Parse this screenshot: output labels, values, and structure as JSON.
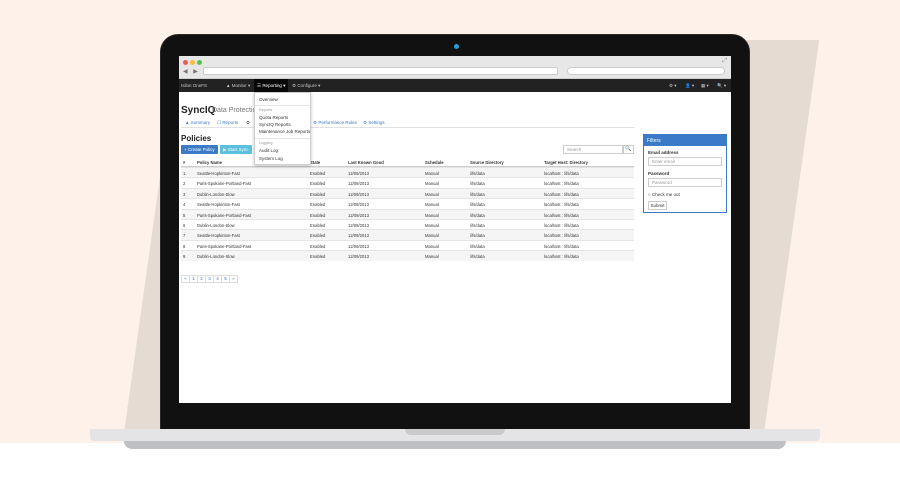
{
  "browser": {
    "url": "",
    "search_placeholder": "",
    "nav_buttons": "◀ ▶",
    "resize_glyph": "⤢"
  },
  "navbar": {
    "brand": "Isilon OneFS",
    "items": [
      {
        "label": "Monitor ▾",
        "icon": "monitor-icon"
      },
      {
        "label": "Reporting ▾",
        "icon": "table-icon",
        "active": true
      },
      {
        "label": "Configure ▾",
        "icon": "gear-icon"
      }
    ],
    "right": [
      "⚙ ▾",
      "👤 ▾",
      "▦ ▾",
      "🔍 ▾"
    ]
  },
  "page": {
    "title": "SyncIQ",
    "subtitle": "Data Protection"
  },
  "tabs": [
    "Summary",
    "Reports",
    "Performance Rules",
    "Settings"
  ],
  "tab_icons": [
    "bar-chart-icon",
    "document-icon",
    "gear-icon",
    "gear-icon"
  ],
  "policies": {
    "heading": "Policies",
    "create_button": "Create Policy",
    "start_sync_button": "Start Sync",
    "search_placeholder": "Search",
    "search_button": "🔍",
    "columns": [
      "#",
      "Policy Name",
      "State",
      "Last Known Good",
      "Schedule",
      "Source Directory",
      "Target Host: Directory"
    ],
    "rows": [
      [
        "1",
        "Seattle-Hopkinton-Fast",
        "Enabled",
        "12/09/2013",
        "Manual",
        "/ifs/data",
        "localhost : /ifs/data"
      ],
      [
        "2",
        "Paris-Spokane-Portland-Fast",
        "Enabled",
        "12/09/2013",
        "Manual",
        "/ifs/data",
        "localhost : /ifs/data"
      ],
      [
        "3",
        "Dublin-London-Slow",
        "Enabled",
        "12/09/2013",
        "Manual",
        "/ifs/data",
        "localhost : /ifs/data"
      ],
      [
        "4",
        "Seattle-Hopkinton-Fast",
        "Enabled",
        "12/09/2013",
        "Manual",
        "/ifs/data",
        "localhost : /ifs/data"
      ],
      [
        "5",
        "Paris-Spokane-Portland-Fast",
        "Enabled",
        "12/09/2013",
        "Manual",
        "/ifs/data",
        "localhost : /ifs/data"
      ],
      [
        "6",
        "Dublin-London-Slow",
        "Enabled",
        "12/09/2013",
        "Manual",
        "/ifs/data",
        "localhost : /ifs/data"
      ],
      [
        "7",
        "Seattle-Hopkinton-Fast",
        "Enabled",
        "12/09/2013",
        "Manual",
        "/ifs/data",
        "localhost : /ifs/data"
      ],
      [
        "8",
        "Paris-Spokane-Portland-Fast",
        "Enabled",
        "12/09/2013",
        "Manual",
        "/ifs/data",
        "localhost : /ifs/data"
      ],
      [
        "9",
        "Dublin-London-Slow",
        "Enabled",
        "12/09/2013",
        "Manual",
        "/ifs/data",
        "localhost : /ifs/data"
      ]
    ],
    "pagination": [
      "«",
      "1",
      "2",
      "3",
      "4",
      "5",
      "»"
    ]
  },
  "reporting_menu": {
    "overview": "Overview",
    "section_reports": "Reports",
    "reports": [
      "Quota Reports",
      "SyncIQ Reports",
      "Maintenance Job Reports"
    ],
    "section_logging": "Logging",
    "logging": [
      "Audit Log",
      "System Log"
    ]
  },
  "filters": {
    "title": "Filters",
    "email_label": "Email address",
    "email_placeholder": "Enter email",
    "password_label": "Password",
    "password_placeholder": "Password",
    "checkbox_label": "Check me out",
    "submit": "Submit"
  },
  "colors": {
    "primary": "#3a7ac6",
    "info": "#5bc0de",
    "navbar": "#222222",
    "backdrop": "#fdf1e9"
  }
}
